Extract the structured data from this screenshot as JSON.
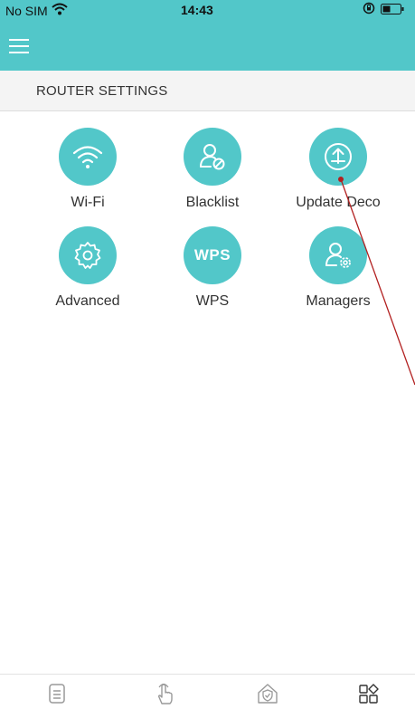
{
  "status_bar": {
    "carrier": "No SIM",
    "time": "14:43"
  },
  "header": {
    "menu_icon": "hamburger-icon"
  },
  "section": {
    "title": "ROUTER SETTINGS"
  },
  "tiles": [
    {
      "label": "Wi-Fi",
      "icon": "wifi-icon"
    },
    {
      "label": "Blacklist",
      "icon": "user-block-icon"
    },
    {
      "label": "Update Deco",
      "icon": "upload-icon"
    },
    {
      "label": "Advanced",
      "icon": "gear-icon"
    },
    {
      "label": "WPS",
      "icon": "wps-icon",
      "icon_text": "WPS"
    },
    {
      "label": "Managers",
      "icon": "user-gear-icon"
    }
  ],
  "tabbar": [
    {
      "icon": "list-icon"
    },
    {
      "icon": "tap-hand-icon"
    },
    {
      "icon": "home-shield-icon"
    },
    {
      "icon": "grid-more-icon",
      "active": true
    }
  ],
  "colors": {
    "accent": "#52c7c9",
    "annotation_line": "#b22020"
  }
}
